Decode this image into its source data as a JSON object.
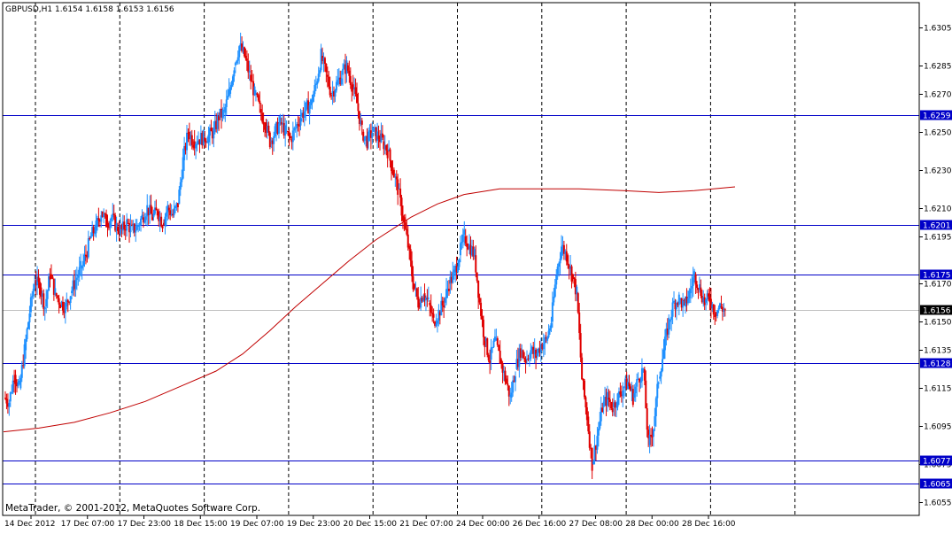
{
  "header": {
    "title": "GBPUSD,H1  1.6154 1.6158 1.6153 1.6156"
  },
  "footer": {
    "copyright": "MetaTrader, © 2001-2012, MetaQuotes Software Corp."
  },
  "colors": {
    "background": "#ffffff",
    "frame": "#000000",
    "bull": "#1e90ff",
    "bear": "#e00000",
    "ma": "#c00000",
    "level": "#0000c8",
    "level_label_bg": "#0000c8",
    "level_label_text": "#ffffff",
    "bid_line": "#c0c0c0",
    "bid_label_bg": "#000000",
    "bid_label_text": "#ffffff",
    "grid": "#000000"
  },
  "chart_data": {
    "type": "candlestick",
    "symbol": "GBPUSD",
    "timeframe": "H1",
    "ylim": [
      1.6048,
      1.6318
    ],
    "price_ticks": [
      "1.6305",
      "1.6285",
      "1.6270",
      "1.6250",
      "1.6230",
      "1.6210",
      "1.6195",
      "1.6170",
      "1.6150",
      "1.6135",
      "1.6115",
      "1.6095",
      "1.6075",
      "1.6055"
    ],
    "time_ticks": [
      "14 Dec 2012",
      "17 Dec 07:00",
      "17 Dec 23:00",
      "18 Dec 15:00",
      "19 Dec 07:00",
      "19 Dec 23:00",
      "20 Dec 15:00",
      "21 Dec 07:00",
      "24 Dec 00:00",
      "26 Dec 16:00",
      "27 Dec 08:00",
      "28 Dec 00:00",
      "28 Dec 16:00"
    ],
    "vgrid_count": 10,
    "horizontal_levels": [
      "1.6259",
      "1.6201",
      "1.6175",
      "1.6128",
      "1.6077",
      "1.6065"
    ],
    "bid": "1.6156",
    "ohlc_path": [
      1.611,
      1.6108,
      1.6122,
      1.6115,
      1.6135,
      1.6155,
      1.6172,
      1.6168,
      1.6158,
      1.6175,
      1.6165,
      1.616,
      1.6158,
      1.6165,
      1.6172,
      1.6178,
      1.6185,
      1.6195,
      1.62,
      1.6208,
      1.6202,
      1.6205,
      1.62,
      1.6198,
      1.6202,
      1.6198,
      1.62,
      1.6205,
      1.621,
      1.6205,
      1.6208,
      1.6202,
      1.621,
      1.6206,
      1.6212,
      1.6235,
      1.625,
      1.6245,
      1.6246,
      1.6247,
      1.6248,
      1.625,
      1.6258,
      1.626,
      1.627,
      1.6285,
      1.6295,
      1.629,
      1.628,
      1.627,
      1.6262,
      1.6255,
      1.6245,
      1.625,
      1.6255,
      1.625,
      1.6246,
      1.6252,
      1.6258,
      1.6262,
      1.6265,
      1.6275,
      1.629,
      1.628,
      1.627,
      1.6275,
      1.628,
      1.6285,
      1.6275,
      1.6265,
      1.625,
      1.6245,
      1.625,
      1.6248,
      1.6245,
      1.624,
      1.623,
      1.622,
      1.6205,
      1.619,
      1.617,
      1.616,
      1.6165,
      1.616,
      1.615,
      1.6155,
      1.616,
      1.617,
      1.6175,
      1.6185,
      1.6195,
      1.619,
      1.6185,
      1.616,
      1.614,
      1.613,
      1.614,
      1.613,
      1.612,
      1.611,
      1.6125,
      1.6135,
      1.613,
      1.6135,
      1.6132,
      1.6138,
      1.614,
      1.615,
      1.6175,
      1.619,
      1.6185,
      1.6175,
      1.6165,
      1.612,
      1.61,
      1.6075,
      1.609,
      1.6105,
      1.611,
      1.6105,
      1.611,
      1.6115,
      1.6118,
      1.611,
      1.612,
      1.6125,
      1.6085,
      1.6095,
      1.612,
      1.6135,
      1.615,
      1.616,
      1.6162,
      1.6158,
      1.6165,
      1.6175,
      1.6168,
      1.616,
      1.6162,
      1.6155,
      1.6158,
      1.6156
    ],
    "ma_path": [
      [
        0,
        1.6092
      ],
      [
        40,
        1.6094
      ],
      [
        80,
        1.6097
      ],
      [
        120,
        1.6102
      ],
      [
        160,
        1.6108
      ],
      [
        200,
        1.6116
      ],
      [
        240,
        1.6124
      ],
      [
        270,
        1.6133
      ],
      [
        300,
        1.6145
      ],
      [
        330,
        1.6158
      ],
      [
        360,
        1.617
      ],
      [
        390,
        1.6182
      ],
      [
        420,
        1.6193
      ],
      [
        460,
        1.6205
      ],
      [
        490,
        1.6212
      ],
      [
        520,
        1.6217
      ],
      [
        560,
        1.622
      ],
      [
        600,
        1.622
      ],
      [
        650,
        1.622
      ],
      [
        700,
        1.6219
      ],
      [
        740,
        1.6218
      ],
      [
        780,
        1.6219
      ],
      [
        826,
        1.6221
      ]
    ]
  }
}
